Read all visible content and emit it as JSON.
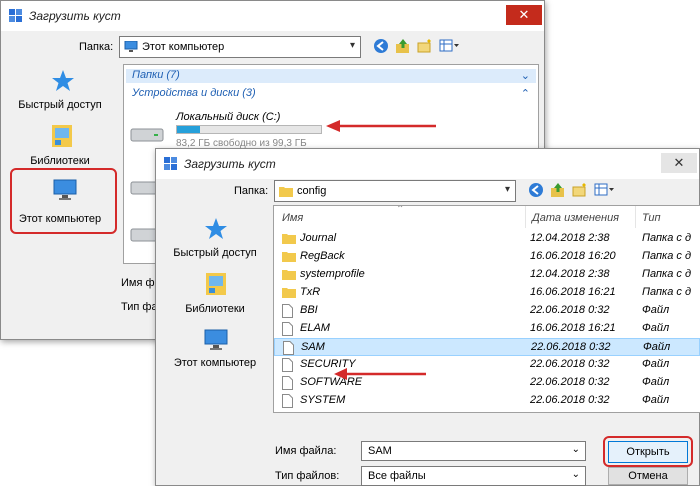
{
  "back_dialog": {
    "title": "Загрузить куст",
    "close_glyph": "✕",
    "folder_label": "Папка:",
    "folder_value": "Этот компьютер",
    "places": [
      {
        "label": "Быстрый доступ",
        "icon": "star-icon"
      },
      {
        "label": "Библиотеки",
        "icon": "libraries-icon"
      },
      {
        "label": "Этот компьютер",
        "icon": "computer-icon"
      }
    ],
    "groups": [
      {
        "label": "Папки (7)",
        "chevron": "⌄"
      },
      {
        "label": "Устройства и диски (3)",
        "chevron": "⌃"
      }
    ],
    "drive": {
      "name": "Локальный диск (C:)",
      "free": "83,2 ГБ свободно из 99,3 ГБ",
      "used_fraction": 0.16
    },
    "filename_label": "Имя файл",
    "filetype_label": "Тип файл"
  },
  "front_dialog": {
    "title": "Загрузить куст",
    "close_glyph": "✕",
    "folder_label": "Папка:",
    "folder_value": "config",
    "places": [
      {
        "label": "Быстрый доступ",
        "icon": "star-icon"
      },
      {
        "label": "Библиотеки",
        "icon": "libraries-icon"
      },
      {
        "label": "Этот компьютер",
        "icon": "computer-icon"
      }
    ],
    "columns": {
      "name": "Имя",
      "date": "Дата изменения",
      "type": "Тип"
    },
    "files": [
      {
        "name": "Journal",
        "date": "12.04.2018 2:38",
        "type": "Папка с д",
        "kind": "folder"
      },
      {
        "name": "RegBack",
        "date": "16.06.2018 16:20",
        "type": "Папка с д",
        "kind": "folder"
      },
      {
        "name": "systemprofile",
        "date": "12.04.2018 2:38",
        "type": "Папка с д",
        "kind": "folder"
      },
      {
        "name": "TxR",
        "date": "16.06.2018 16:21",
        "type": "Папка с д",
        "kind": "folder"
      },
      {
        "name": "BBI",
        "date": "22.06.2018 0:32",
        "type": "Файл",
        "kind": "file"
      },
      {
        "name": "ELAM",
        "date": "16.06.2018 16:21",
        "type": "Файл",
        "kind": "file"
      },
      {
        "name": "SAM",
        "date": "22.06.2018 0:32",
        "type": "Файл",
        "kind": "file"
      },
      {
        "name": "SECURITY",
        "date": "22.06.2018 0:32",
        "type": "Файл",
        "kind": "file"
      },
      {
        "name": "SOFTWARE",
        "date": "22.06.2018 0:32",
        "type": "Файл",
        "kind": "file"
      },
      {
        "name": "SYSTEM",
        "date": "22.06.2018 0:32",
        "type": "Файл",
        "kind": "file"
      }
    ],
    "filename_label": "Имя файла:",
    "filename_value": "SAM",
    "filetype_label": "Тип файлов:",
    "filetype_value": "Все файлы",
    "open_button": "Открыть",
    "cancel_button": "Отмена"
  },
  "colors": {
    "accent_red": "#d42a2a",
    "link_blue": "#1e5fb3",
    "selection": "#cce8ff"
  }
}
